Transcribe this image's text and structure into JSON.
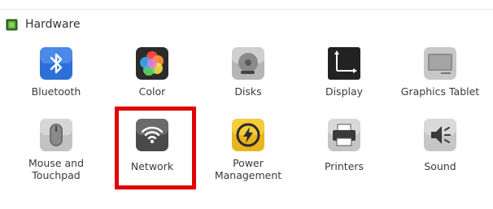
{
  "section": {
    "title": "Hardware",
    "icon": "chip-icon"
  },
  "items": [
    {
      "id": "bluetooth",
      "label": "Bluetooth",
      "icon": "bluetooth-icon"
    },
    {
      "id": "color",
      "label": "Color",
      "icon": "color-icon"
    },
    {
      "id": "disks",
      "label": "Disks",
      "icon": "disks-icon"
    },
    {
      "id": "display",
      "label": "Display",
      "icon": "display-icon"
    },
    {
      "id": "graphics-tablet",
      "label": "Graphics Tablet",
      "icon": "graphics-tablet-icon"
    },
    {
      "id": "mouse-touchpad",
      "label": "Mouse and\nTouchpad",
      "icon": "mouse-icon"
    },
    {
      "id": "network",
      "label": "Network",
      "icon": "network-icon",
      "highlighted": true
    },
    {
      "id": "power",
      "label": "Power\nManagement",
      "icon": "power-icon"
    },
    {
      "id": "printers",
      "label": "Printers",
      "icon": "printer-icon"
    },
    {
      "id": "sound",
      "label": "Sound",
      "icon": "sound-icon"
    }
  ],
  "colors": {
    "highlight": "#e30000",
    "bluetooth": "#2c6fd6",
    "power": "#f2c230"
  }
}
